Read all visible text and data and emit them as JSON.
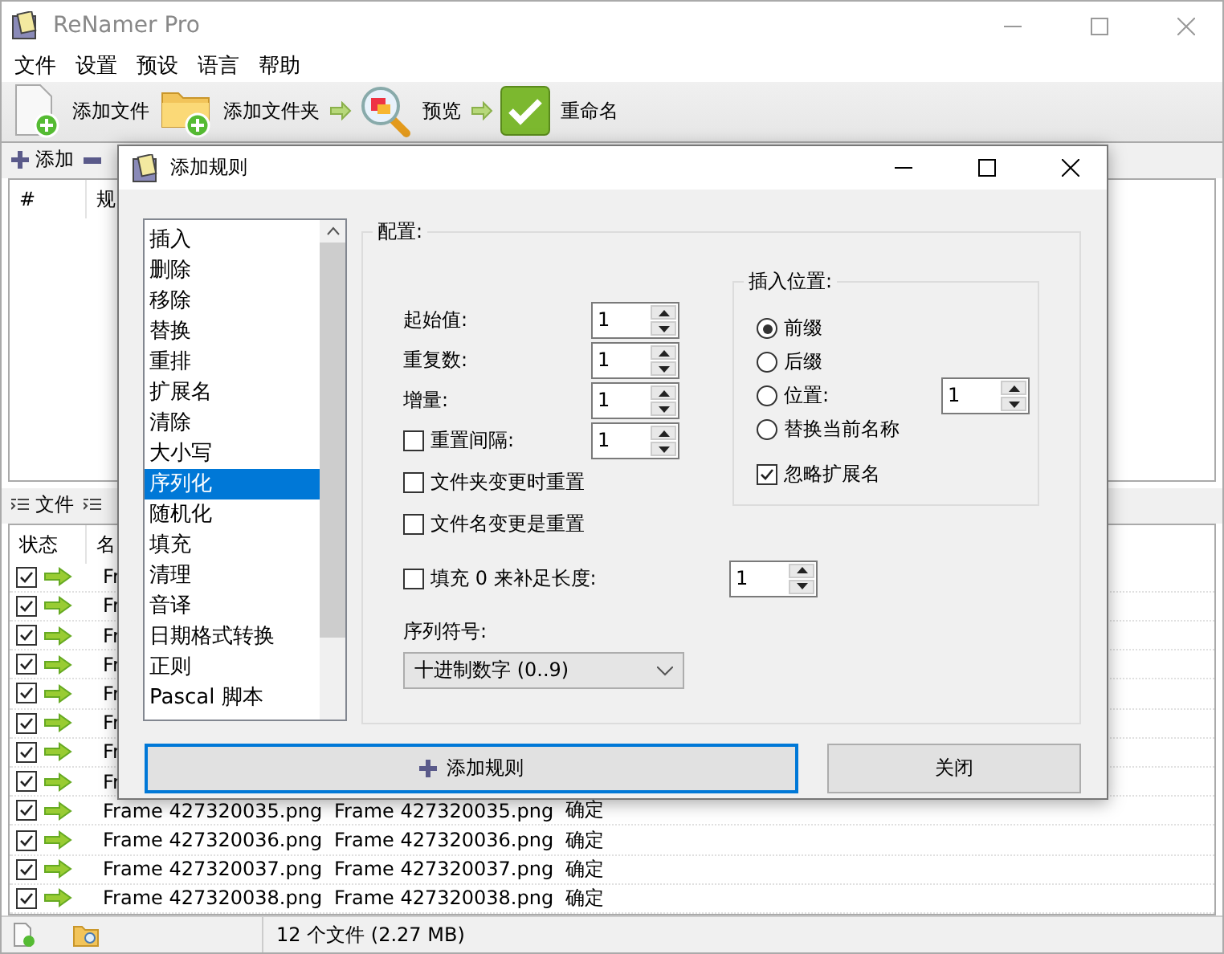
{
  "window": {
    "title": "ReNamer Pro"
  },
  "menu": [
    "文件",
    "设置",
    "预设",
    "语言",
    "帮助"
  ],
  "toolbar": [
    {
      "kind": "add-file",
      "label": "添加文件"
    },
    {
      "kind": "add-folder",
      "label": "添加文件夹"
    },
    {
      "kind": "preview",
      "label": "预览"
    },
    {
      "kind": "rename",
      "label": "重命名"
    }
  ],
  "rules_panel": {
    "add_label": "添加",
    "columns": [
      "#",
      "规"
    ]
  },
  "files_panel": {
    "tab_label": "文件",
    "columns": [
      "状态",
      "名"
    ],
    "rows": [
      {
        "checked": true,
        "name": "Fr"
      },
      {
        "checked": true,
        "name": "Fr"
      },
      {
        "checked": true,
        "name": "Fr"
      },
      {
        "checked": true,
        "name": "Fr"
      },
      {
        "checked": true,
        "name": "Fr"
      },
      {
        "checked": true,
        "name": "Fr"
      },
      {
        "checked": true,
        "name": "Fr"
      },
      {
        "checked": true,
        "name": "Fr"
      },
      {
        "checked": true,
        "name": "Frame 427320035.png",
        "new_name": "Frame 427320035.png",
        "state": "确定"
      },
      {
        "checked": true,
        "name": "Frame 427320036.png",
        "new_name": "Frame 427320036.png",
        "state": "确定"
      },
      {
        "checked": true,
        "name": "Frame 427320037.png",
        "new_name": "Frame 427320037.png",
        "state": "确定"
      },
      {
        "checked": true,
        "name": "Frame 427320038.png",
        "new_name": "Frame 427320038.png",
        "state": "确定"
      }
    ]
  },
  "status_bar": {
    "file_count": "12 个文件 (2.27 MB)"
  },
  "dialog": {
    "title": "添加规则",
    "rules": [
      {
        "label": "插入",
        "selected": false
      },
      {
        "label": "删除",
        "selected": false
      },
      {
        "label": "移除",
        "selected": false
      },
      {
        "label": "替换",
        "selected": false
      },
      {
        "label": "重排",
        "selected": false
      },
      {
        "label": "扩展名",
        "selected": false
      },
      {
        "label": "清除",
        "selected": false
      },
      {
        "label": "大小写",
        "selected": false
      },
      {
        "label": "序列化",
        "selected": true
      },
      {
        "label": "随机化",
        "selected": false
      },
      {
        "label": "填充",
        "selected": false
      },
      {
        "label": "清理",
        "selected": false
      },
      {
        "label": "音译",
        "selected": false
      },
      {
        "label": "日期格式转换",
        "selected": false
      },
      {
        "label": "正则",
        "selected": false
      },
      {
        "label": "Pascal 脚本",
        "selected": false
      }
    ],
    "config_title": "配置:",
    "fields": [
      {
        "kind": "label",
        "label": "起始值:",
        "value": "1"
      },
      {
        "kind": "label",
        "label": "重复数:",
        "value": "1"
      },
      {
        "kind": "label",
        "label": "增量:",
        "value": "1"
      },
      {
        "kind": "checkbox",
        "label": "重置间隔:",
        "checked": false,
        "value": "1"
      }
    ],
    "options": [
      {
        "label": "文件夹变更时重置",
        "checked": false
      },
      {
        "label": "文件名变更是重置",
        "checked": false
      }
    ],
    "pad": {
      "label": "填充 0 来补足长度:",
      "checked": false,
      "value": "1"
    },
    "symbols_label": "序列符号:",
    "symbols_value": "十进制数字 (0..9)",
    "position": {
      "title": "插入位置:",
      "choices": [
        {
          "label": "前缀",
          "selected": true
        },
        {
          "label": "后缀",
          "selected": false
        },
        {
          "label": "位置:",
          "selected": false,
          "value": "1"
        },
        {
          "label": "替换当前名称",
          "selected": false
        }
      ],
      "ignore_ext": {
        "label": "忽略扩展名",
        "checked": true
      }
    },
    "buttons": [
      {
        "kind": "primary",
        "label": "添加规则"
      },
      {
        "kind": "normal",
        "label": "关闭"
      }
    ]
  }
}
